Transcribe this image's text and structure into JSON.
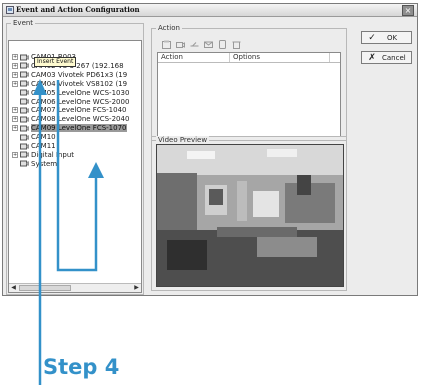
{
  "window": {
    "title": "Event and Action Configuration",
    "close_glyph": "×"
  },
  "event_panel": {
    "label": "Event",
    "toolbar_icons": [
      "insert-event-icon",
      "save-icon",
      "record-icon",
      "schedule-icon",
      "alarm-icon",
      "delete-icon"
    ],
    "tooltip": "Insert Event",
    "tree": [
      {
        "label": "CAM01 B003",
        "expandable": true
      },
      {
        "label": "CAM02 VS-3 267 (192.168",
        "expandable": true
      },
      {
        "label": "CAM03 Vivotek PD61x3 (19",
        "expandable": true
      },
      {
        "label": "CAM04 Vivotek VS8102 (19",
        "expandable": true
      },
      {
        "label": "CAM05 LevelOne WCS-1030",
        "expandable": false
      },
      {
        "label": "CAM06 LevelOne WCS-2000",
        "expandable": false
      },
      {
        "label": "CAM07 LevelOne FCS-1040",
        "expandable": true
      },
      {
        "label": "CAM08 LevelOne WCS-2040",
        "expandable": true
      },
      {
        "label": "CAM09 LevelOne FCS-1070",
        "expandable": true,
        "selected": true
      },
      {
        "label": "CAM10",
        "expandable": false
      },
      {
        "label": "CAM11",
        "expandable": false
      },
      {
        "label": "Digital Input",
        "expandable": true
      },
      {
        "label": "System",
        "expandable": false
      }
    ]
  },
  "action_panel": {
    "label": "Action",
    "toolbar_icons": [
      "add-action-icon",
      "camera-icon",
      "relay-icon",
      "email-icon",
      "phone-icon",
      "delete-icon"
    ],
    "columns": [
      "Action",
      "Options"
    ]
  },
  "video_panel": {
    "label": "Video Preview"
  },
  "buttons": {
    "ok": "OK",
    "cancel": "Cancel",
    "ok_icon": "✓",
    "cancel_icon": "✗"
  },
  "annotation": {
    "step_label": "Step 4"
  },
  "colors": {
    "annotation": "#3391c9",
    "selection": "#9a9a9a"
  }
}
